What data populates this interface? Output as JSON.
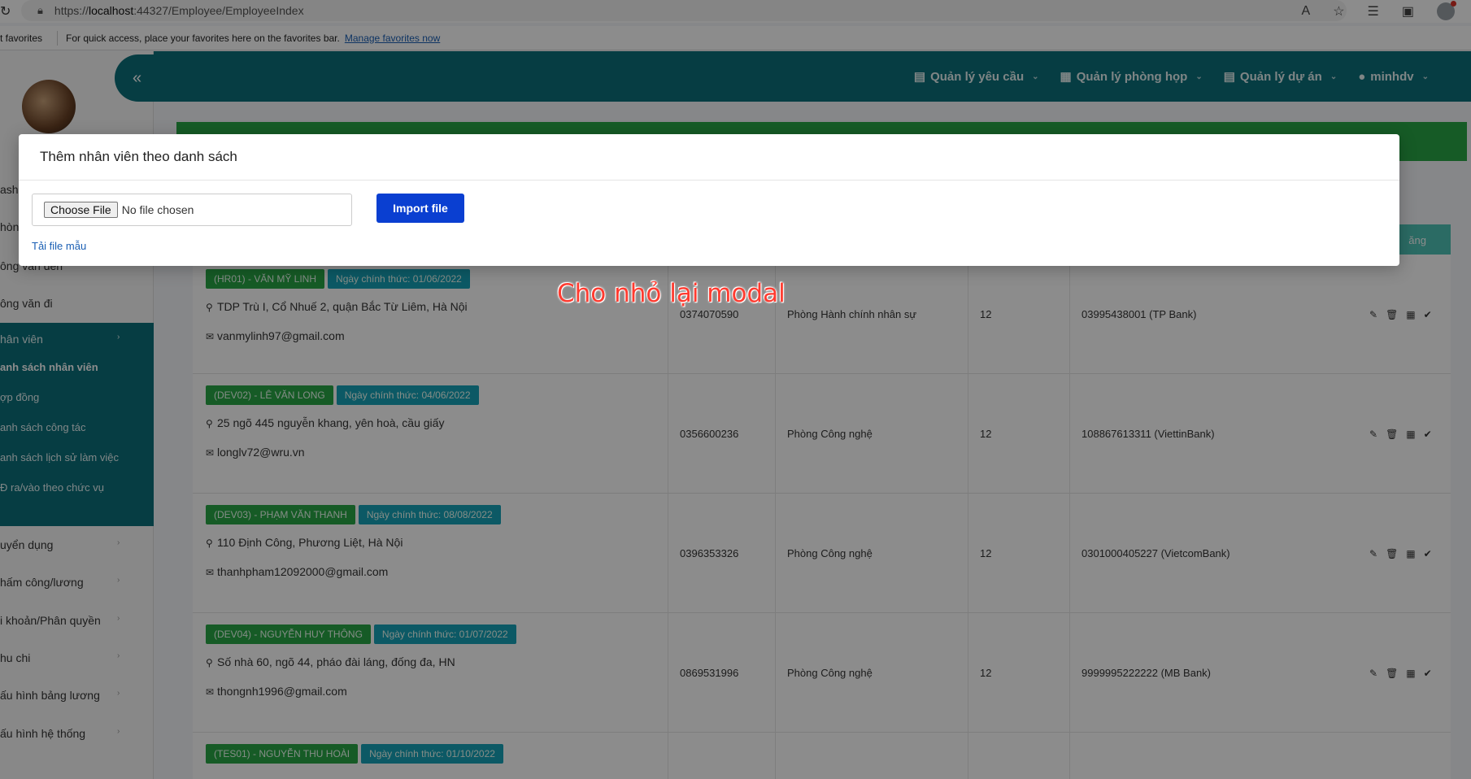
{
  "browser": {
    "url_prefix": "https://",
    "url_host": "localhost",
    "url_rest": ":44327/Employee/EmployeeIndex",
    "fav_left": "t favorites",
    "fav_message": "For quick access, place your favorites here on the favorites bar.",
    "fav_link": "Manage favorites now"
  },
  "topnav": {
    "items": [
      {
        "label": "Quản lý yêu cầu",
        "icon": "list-icon"
      },
      {
        "label": "Quản lý phòng họp",
        "icon": "calendar-icon"
      },
      {
        "label": "Quản lý dự án",
        "icon": "list-icon"
      },
      {
        "label": "minhdv",
        "icon": "user-icon"
      }
    ]
  },
  "sidebar": {
    "items": [
      {
        "label": "ashb"
      },
      {
        "label": "hòng"
      },
      {
        "label": "ông văn đến"
      },
      {
        "label": "ông văn đi"
      },
      {
        "label": "hân viên"
      }
    ],
    "sub_items": [
      {
        "label": "anh sách nhân viên"
      },
      {
        "label": "ợp đồng"
      },
      {
        "label": "anh sách công tác"
      },
      {
        "label": "anh sách lịch sử làm việc"
      },
      {
        "label": "Đ ra/vào theo chức vụ"
      }
    ],
    "lower_items": [
      {
        "label": "uyển dụng"
      },
      {
        "label": "hấm công/lương"
      },
      {
        "label": "i khoản/Phân quyền"
      },
      {
        "label": "hu chi"
      },
      {
        "label": "ấu hình bảng lương"
      },
      {
        "label": "ấu hình hệ thống"
      }
    ]
  },
  "table": {
    "header_right": "ăng",
    "rows": [
      {
        "code": "(HR01) - VĂN MỸ LINH",
        "date": "Ngày chính thức: 01/06/2022",
        "address": "TDP Trù I, Cổ Nhuế 2, quận Bắc Từ Liêm, Hà Nội",
        "email": "vanmylinh97@gmail.com",
        "phone": "0374070590",
        "dept": "Phòng Hành chính nhân sự",
        "days": "12",
        "bank": "03995438001 (TP Bank)"
      },
      {
        "code": "(DEV02) - LÊ VĂN LONG",
        "date": "Ngày chính thức: 04/06/2022",
        "address": "25 ngõ 445 nguyễn khang, yên hoà, cầu giấy",
        "email": "longlv72@wru.vn",
        "phone": "0356600236",
        "dept": "Phòng Công nghệ",
        "days": "12",
        "bank": "108867613311 (ViettinBank)"
      },
      {
        "code": "(DEV03) - PHẠM VĂN THANH",
        "date": "Ngày chính thức: 08/08/2022",
        "address": "110 Định Công, Phương Liệt, Hà Nội",
        "email": "thanhpham12092000@gmail.com",
        "phone": "0396353326",
        "dept": "Phòng Công nghệ",
        "days": "12",
        "bank": "0301000405227 (VietcomBank)"
      },
      {
        "code": "(DEV04) - NGUYỄN HUY THÔNG",
        "date": "Ngày chính thức: 01/07/2022",
        "address": "Số nhà 60, ngõ 44, pháo đài láng, đống đa, HN",
        "email": "thongnh1996@gmail.com",
        "phone": "0869531996",
        "dept": "Phòng Công nghệ",
        "days": "12",
        "bank": "9999995222222 (MB Bank)"
      },
      {
        "code": "(TES01) - NGUYỄN THU HOÀI",
        "date": "Ngày chính thức: 01/10/2022"
      }
    ]
  },
  "modal": {
    "title": "Thêm nhân viên theo danh sách",
    "choose_file": "Choose File",
    "no_file": "No file chosen",
    "import_button": "Import file",
    "template_link": "Tải file mẫu"
  },
  "annotation": "Cho nhỏ lại modal",
  "colors": {
    "teal": "#0b6f7a",
    "green": "#28a745",
    "cyan": "#17a2b8",
    "import_blue": "#0a3fd1",
    "annotation_red": "#ff3b30"
  }
}
